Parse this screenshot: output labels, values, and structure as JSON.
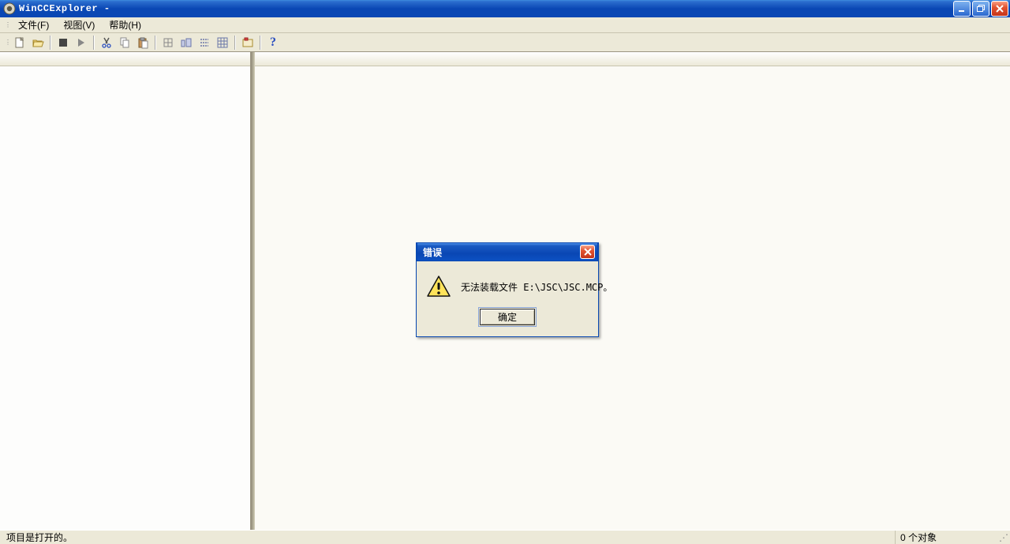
{
  "window": {
    "title": "WinCCExplorer -"
  },
  "menu": {
    "file": "文件(F)",
    "view": "视图(V)",
    "help": "帮助(H)"
  },
  "status": {
    "left": "项目是打开的。",
    "right": "0 个对象"
  },
  "dialog": {
    "title": "错误",
    "message": "无法装载文件 E:\\JSC\\JSC.MCP。",
    "ok": "确定"
  }
}
